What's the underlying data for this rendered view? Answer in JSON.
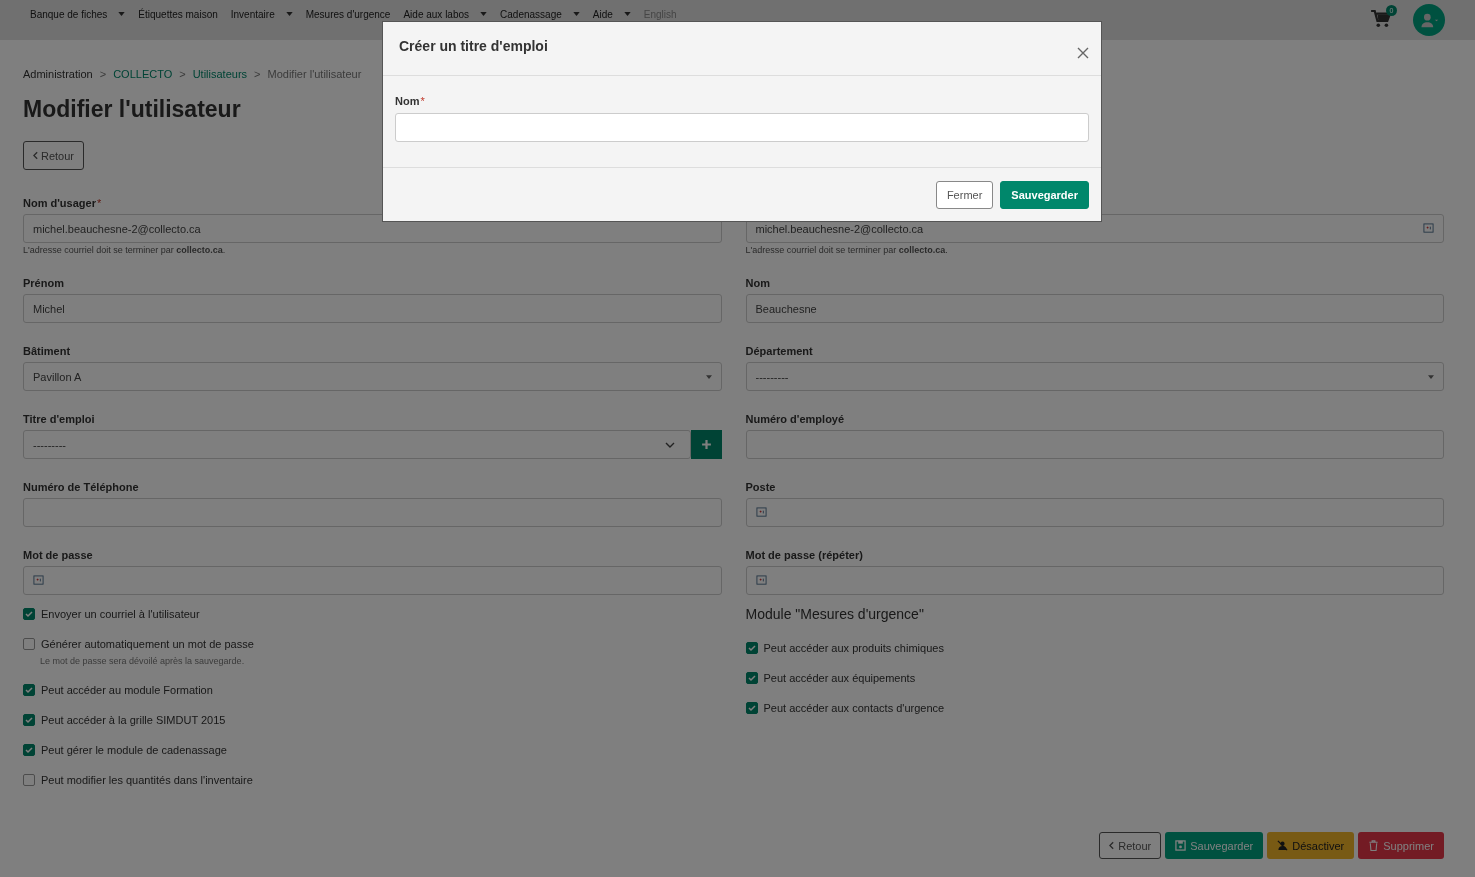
{
  "nav": {
    "items": [
      {
        "label": "Banque de fiches",
        "dropdown": true,
        "disabled": false
      },
      {
        "label": "Étiquettes maison",
        "dropdown": false,
        "disabled": false
      },
      {
        "label": "Inventaire",
        "dropdown": true,
        "disabled": false
      },
      {
        "label": "Mesures d'urgence",
        "dropdown": false,
        "disabled": false
      },
      {
        "label": "Aide aux labos",
        "dropdown": true,
        "disabled": false
      },
      {
        "label": "Cadenassage",
        "dropdown": true,
        "disabled": false
      },
      {
        "label": "Aide",
        "dropdown": true,
        "disabled": false
      },
      {
        "label": "English",
        "dropdown": false,
        "disabled": true
      }
    ],
    "cart_count": "0"
  },
  "breadcrumb": [
    {
      "label": "Administration",
      "kind": "text"
    },
    {
      "separator": ">",
      "label": "COLLECTO",
      "kind": "link"
    },
    {
      "separator": ">",
      "label": "Utilisateurs",
      "kind": "link"
    },
    {
      "separator": ">",
      "label": "Modifier l'utilisateur",
      "kind": "current"
    }
  ],
  "title": "Modifier l'utilisateur",
  "back_button": "Retour",
  "fields": [
    {
      "label": "Nom d'usager",
      "required_mark": "*",
      "kind": "text",
      "value": "michel.beauchesne-2@collecto.ca",
      "help": "L'adresse courriel doit se terminer par **collecto.ca**.",
      "autofill_icon": false
    },
    {
      "kind": "text",
      "value": "michel.beauchesne-2@collecto.ca",
      "help": "L'adresse courriel doit se terminer par **collecto.ca**.",
      "autofill_icon": true
    },
    {
      "label": "Prénom",
      "kind": "text",
      "value": "Michel",
      "autofill_icon": false
    },
    {
      "label": "Nom",
      "kind": "text",
      "value": "Beauchesne",
      "autofill_icon": false
    },
    {
      "label": "Bâtiment",
      "kind": "select",
      "value": "Pavillon A",
      "autofill_icon": false
    },
    {
      "label": "Département",
      "kind": "select",
      "value": "---------",
      "autofill_icon": false
    },
    {
      "label": "Titre d'emploi",
      "kind": "select-add",
      "value": "---------",
      "autofill_icon": false
    },
    {
      "label": "Numéro d'employé",
      "kind": "text",
      "autofill_icon": false
    },
    {
      "label": "Numéro de Téléphone",
      "kind": "text",
      "autofill_icon": false
    },
    {
      "label": "Poste",
      "kind": "text",
      "autofill_icon": true
    },
    {
      "label": "Mot de passe",
      "kind": "password",
      "autofill_icon": true
    },
    {
      "label": "Mot de passe (répéter)",
      "kind": "password",
      "autofill_icon": true
    }
  ],
  "left_checkboxes": [
    {
      "label": "Envoyer un courriel à l'utilisateur",
      "checked": true
    },
    {
      "label": "Générer automatiquement un mot de passe",
      "checked": false,
      "note": "Le mot de passe sera dévoilé après la sauvegarde."
    },
    {
      "label": "Peut accéder au module Formation",
      "checked": true
    },
    {
      "label": "Peut accéder à la grille SIMDUT 2015",
      "checked": true
    },
    {
      "label": "Peut gérer le module de cadenassage",
      "checked": true
    },
    {
      "label": "Peut modifier les quantités dans l'inventaire",
      "checked": false
    }
  ],
  "emergency_module": {
    "heading": "Module \"Mesures d'urgence\"",
    "checkboxes": [
      {
        "label": "Peut accéder aux produits chimiques",
        "checked": true
      },
      {
        "label": "Peut accéder aux équipements",
        "checked": true
      },
      {
        "label": "Peut accéder aux contacts d'urgence",
        "checked": true
      }
    ]
  },
  "footer_buttons": [
    {
      "label": "Retour",
      "kind": "back"
    },
    {
      "label": "Sauvegarder",
      "kind": "save"
    },
    {
      "label": "Désactiver",
      "kind": "deactivate"
    },
    {
      "label": "Supprimer",
      "kind": "delete"
    }
  ],
  "modal": {
    "title": "Créer un titre d'emploi",
    "field_label": "Nom",
    "required_mark": "*",
    "buttons": [
      {
        "label": "Fermer",
        "kind": "secondary"
      },
      {
        "label": "Sauvegarder",
        "kind": "primary"
      }
    ]
  }
}
